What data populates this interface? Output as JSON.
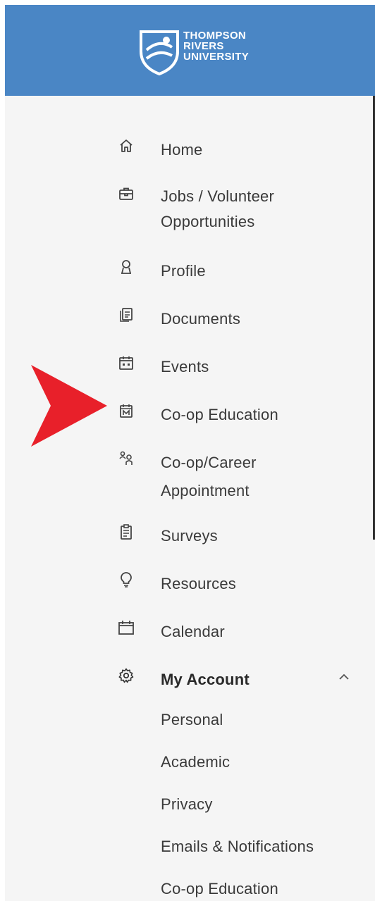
{
  "brand": {
    "line1": "THOMPSON",
    "line2": "RIVERS",
    "line3": "UNIVERSITY",
    "color": "#4a86c5"
  },
  "nav": {
    "home": "Home",
    "jobs_line1": "Jobs / Volunteer",
    "jobs_line2": "Opportunities",
    "profile": "Profile",
    "documents": "Documents",
    "events": "Events",
    "coop_education": "Co-op Education",
    "appointment_line1": "Co-op/Career",
    "appointment_line2": "Appointment",
    "surveys": "Surveys",
    "resources": "Resources",
    "calendar": "Calendar",
    "my_account": "My Account"
  },
  "account_submenu": {
    "personal": "Personal",
    "academic": "Academic",
    "privacy": "Privacy",
    "emails": "Emails & Notifications",
    "coop_education": "Co-op Education"
  },
  "annotation": {
    "arrow_color": "#e8202a"
  }
}
